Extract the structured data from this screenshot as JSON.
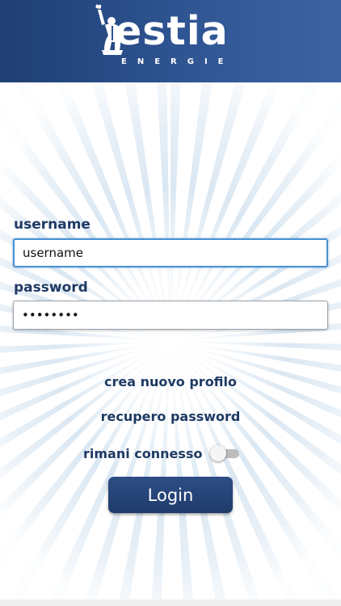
{
  "header": {
    "logo_word": "estia",
    "logo_sub": "ENERGIE",
    "logo_icon": "statue-icon"
  },
  "form": {
    "username_label": "username",
    "username_value": "username",
    "password_label": "password",
    "password_value": "password",
    "create_profile": "crea nuovo profilo",
    "recover_password": "recupero password",
    "remember_label": "rimani connesso",
    "remember_on": false,
    "login_label": "Login"
  },
  "colors": {
    "header_bg": "#2f5593",
    "text_primary": "#1f3a63",
    "focus_border": "#4a90d0",
    "button_bg": "#24447a"
  }
}
